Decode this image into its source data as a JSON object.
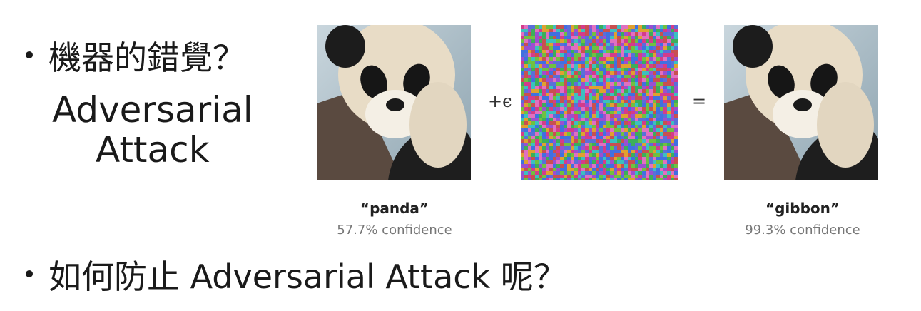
{
  "bullets": {
    "first": "機器的錯覺？",
    "first_sub": [
      "Adversarial",
      "Attack"
    ],
    "second": "如何防止 Adversarial Attack 呢？"
  },
  "equation": {
    "plus": "+ϵ",
    "equals": "="
  },
  "captions": {
    "left": {
      "label": "“panda”",
      "confidence": "57.7% confidence"
    },
    "right": {
      "label": "“gibbon”",
      "confidence": "99.3% confidence"
    }
  },
  "images": {
    "left": "panda-photo",
    "middle": "adversarial-noise",
    "right": "panda-photo-perturbed"
  }
}
